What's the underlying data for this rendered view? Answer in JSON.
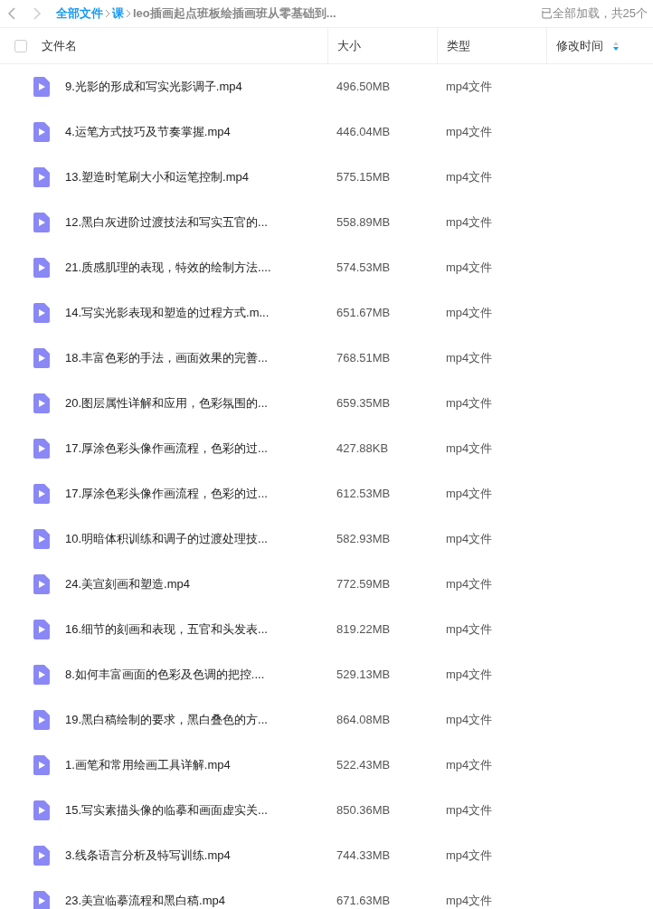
{
  "breadcrumb": {
    "items": [
      {
        "label": "全部文件",
        "current": false
      },
      {
        "label": "课",
        "current": false
      },
      {
        "label": "leo插画起点班板绘插画班从零基础到...",
        "current": true
      }
    ],
    "status": "已全部加载，共25个"
  },
  "table": {
    "select_all": {
      "checked": false
    },
    "columns": [
      "文件名",
      "大小",
      "类型",
      "修改时间"
    ],
    "sort": {
      "descending": true
    },
    "rows": [
      {
        "name": "9.光影的形成和写实光影调子.mp4",
        "size": "496.50MB",
        "type": "mp4文件"
      },
      {
        "name": "4.运笔方式技巧及节奏掌握.mp4",
        "size": "446.04MB",
        "type": "mp4文件"
      },
      {
        "name": "13.塑造时笔刷大小和运笔控制.mp4",
        "size": "575.15MB",
        "type": "mp4文件"
      },
      {
        "name": "12.黑白灰进阶过渡技法和写实五官的...",
        "size": "558.89MB",
        "type": "mp4文件"
      },
      {
        "name": "21.质感肌理的表现，特效的绘制方法....",
        "size": "574.53MB",
        "type": "mp4文件"
      },
      {
        "name": "14.写实光影表现和塑造的过程方式.m...",
        "size": "651.67MB",
        "type": "mp4文件"
      },
      {
        "name": "18.丰富色彩的手法，画面效果的完善...",
        "size": "768.51MB",
        "type": "mp4文件"
      },
      {
        "name": "20.图层属性详解和应用，色彩氛围的...",
        "size": "659.35MB",
        "type": "mp4文件"
      },
      {
        "name": "17.厚涂色彩头像作画流程，色彩的过...",
        "size": "427.88KB",
        "type": "mp4文件"
      },
      {
        "name": "17.厚涂色彩头像作画流程，色彩的过...",
        "size": "612.53MB",
        "type": "mp4文件"
      },
      {
        "name": "10.明暗体积训练和调子的过渡处理技...",
        "size": "582.93MB",
        "type": "mp4文件"
      },
      {
        "name": "24.美宣刻画和塑造.mp4",
        "size": "772.59MB",
        "type": "mp4文件"
      },
      {
        "name": "16.细节的刻画和表现，五官和头发表...",
        "size": "819.22MB",
        "type": "mp4文件"
      },
      {
        "name": "8.如何丰富画面的色彩及色调的把控....",
        "size": "529.13MB",
        "type": "mp4文件"
      },
      {
        "name": "19.黑白稿绘制的要求，黑白叠色的方...",
        "size": "864.08MB",
        "type": "mp4文件"
      },
      {
        "name": "1.画笔和常用绘画工具详解.mp4",
        "size": "522.43MB",
        "type": "mp4文件"
      },
      {
        "name": "15.写实素描头像的临摹和画面虚实关...",
        "size": "850.36MB",
        "type": "mp4文件"
      },
      {
        "name": "3.线条语言分析及特写训练.mp4",
        "size": "744.33MB",
        "type": "mp4文件"
      },
      {
        "name": "23.美宣临摹流程和黑白稿.mp4",
        "size": "671.63MB",
        "type": "mp4文件"
      }
    ]
  }
}
